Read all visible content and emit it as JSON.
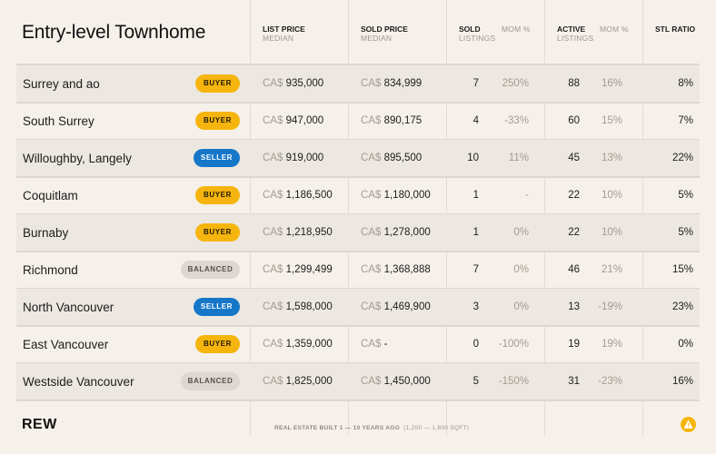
{
  "title": "Entry-level Townhome",
  "headers": {
    "list_price": "LIST PRICE",
    "list_price_sub": "MEDIAN",
    "sold_price": "SOLD PRICE",
    "sold_price_sub": "MEDIAN",
    "sold": "SOLD",
    "sold_sub": "LISTINGS",
    "sold_mom": "MOM %",
    "active": "ACTIVE",
    "active_sub": "LISTINGS",
    "active_mom": "MOM %",
    "stl": "STL RATIO"
  },
  "currency": "CA$",
  "rows": [
    {
      "name": "Surrey and ao",
      "badge": "BUYER",
      "badge_type": "buyer",
      "list": "935,000",
      "sold_price": "834,999",
      "sold": "7",
      "sold_mom": "250%",
      "active": "88",
      "active_mom": "16%",
      "stl": "8%"
    },
    {
      "name": "South Surrey",
      "badge": "BUYER",
      "badge_type": "buyer",
      "list": "947,000",
      "sold_price": "890,175",
      "sold": "4",
      "sold_mom": "-33%",
      "active": "60",
      "active_mom": "15%",
      "stl": "7%"
    },
    {
      "name": "Willoughby, Langely",
      "badge": "SELLER",
      "badge_type": "seller",
      "list": "919,000",
      "sold_price": "895,500",
      "sold": "10",
      "sold_mom": "11%",
      "active": "45",
      "active_mom": "13%",
      "stl": "22%"
    },
    {
      "name": "Coquitlam",
      "badge": "BUYER",
      "badge_type": "buyer",
      "list": "1,186,500",
      "sold_price": "1,180,000",
      "sold": "1",
      "sold_mom": "-",
      "active": "22",
      "active_mom": "10%",
      "stl": "5%"
    },
    {
      "name": "Burnaby",
      "badge": "BUYER",
      "badge_type": "buyer",
      "list": "1,218,950",
      "sold_price": "1,278,000",
      "sold": "1",
      "sold_mom": "0%",
      "active": "22",
      "active_mom": "10%",
      "stl": "5%"
    },
    {
      "name": "Richmond",
      "badge": "BALANCED",
      "badge_type": "balanced",
      "list": "1,299,499",
      "sold_price": "1,368,888",
      "sold": "7",
      "sold_mom": "0%",
      "active": "46",
      "active_mom": "21%",
      "stl": "15%"
    },
    {
      "name": "North Vancouver",
      "badge": "SELLER",
      "badge_type": "seller",
      "list": "1,598,000",
      "sold_price": "1,469,900",
      "sold": "3",
      "sold_mom": "0%",
      "active": "13",
      "active_mom": "-19%",
      "stl": "23%"
    },
    {
      "name": "East Vancouver",
      "badge": "BUYER",
      "badge_type": "buyer",
      "list": "1,359,000",
      "sold_price": "-",
      "sold": "0",
      "sold_mom": "-100%",
      "active": "19",
      "active_mom": "19%",
      "stl": "0%"
    },
    {
      "name": "Westside Vancouver",
      "badge": "BALANCED",
      "badge_type": "balanced",
      "list": "1,825,000",
      "sold_price": "1,450,000",
      "sold": "5",
      "sold_mom": "-150%",
      "active": "31",
      "active_mom": "-23%",
      "stl": "16%"
    }
  ],
  "footer": {
    "logo": "REW",
    "note_bold": "REAL ESTATE BUILT 1 — 10 YEARS AGO",
    "note_light": "(1,200 — 1,600 SQFT)",
    "alert_icon": "alert-triangle-icon",
    "accent_color": "#f6b50e"
  }
}
